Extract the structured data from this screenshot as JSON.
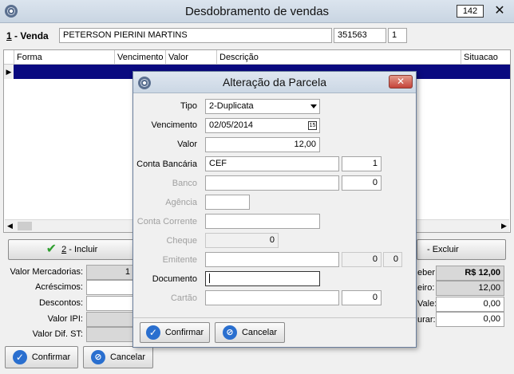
{
  "window": {
    "title": "Desdobramento de vendas",
    "badge": "142",
    "close_glyph": "✕",
    "icon": "app-gear-icon"
  },
  "venda": {
    "label_number": "1",
    "label_text": " - Venda",
    "customer_name": "PETERSON PIERINI MARTINS",
    "code": "351563",
    "seq": "1"
  },
  "grid": {
    "columns": [
      "Forma",
      "Vencimento",
      "Valor",
      "Descrição",
      "Situacao"
    ],
    "row_indicator": "▶"
  },
  "actions": {
    "incluir_key": "2",
    "incluir_text": " - Incluir",
    "excluir_text": "- Excluir"
  },
  "totals_left": {
    "valor_mercadorias_label": "Valor Mercadorias:",
    "valor_mercadorias_value": "1",
    "acrescimos_label": "Acréscimos:",
    "descontos_label": "Descontos:",
    "valor_ipi_label": "Valor IPI:",
    "valor_dif_st_label": "Valor Dif. ST:"
  },
  "totals_right": {
    "label1": "eber:",
    "value1": "R$ 12,00",
    "label2": "eiro:",
    "value2": "12,00",
    "label3": "Vale:",
    "value3": "0,00",
    "label4": "urar:",
    "value4": "0,00"
  },
  "footer": {
    "confirm_label": "Confirmar",
    "cancel_label": "Cancelar"
  },
  "dialog": {
    "title": "Alteração da Parcela",
    "close_glyph": "✕",
    "tipo_label": "Tipo",
    "tipo_value": "2-Duplicata",
    "vencimento_label": "Vencimento",
    "vencimento_value": "02/05/2014",
    "valor_label": "Valor",
    "valor_value": "12,00",
    "conta_label": "Conta Bancária",
    "conta_value": "CEF",
    "conta_num": "1",
    "banco_label": "Banco",
    "banco_num": "0",
    "agencia_label": "Agência",
    "conta_corrente_label": "Conta Corrente",
    "cheque_label": "Cheque",
    "cheque_value": "0",
    "emitente_label": "Emitente",
    "emitente_num1": "0",
    "emitente_num2": "0",
    "documento_label": "Documento",
    "cartao_label": "Cartão",
    "cartao_num": "0",
    "confirm_label": "Confirmar",
    "cancel_label": "Cancelar"
  }
}
